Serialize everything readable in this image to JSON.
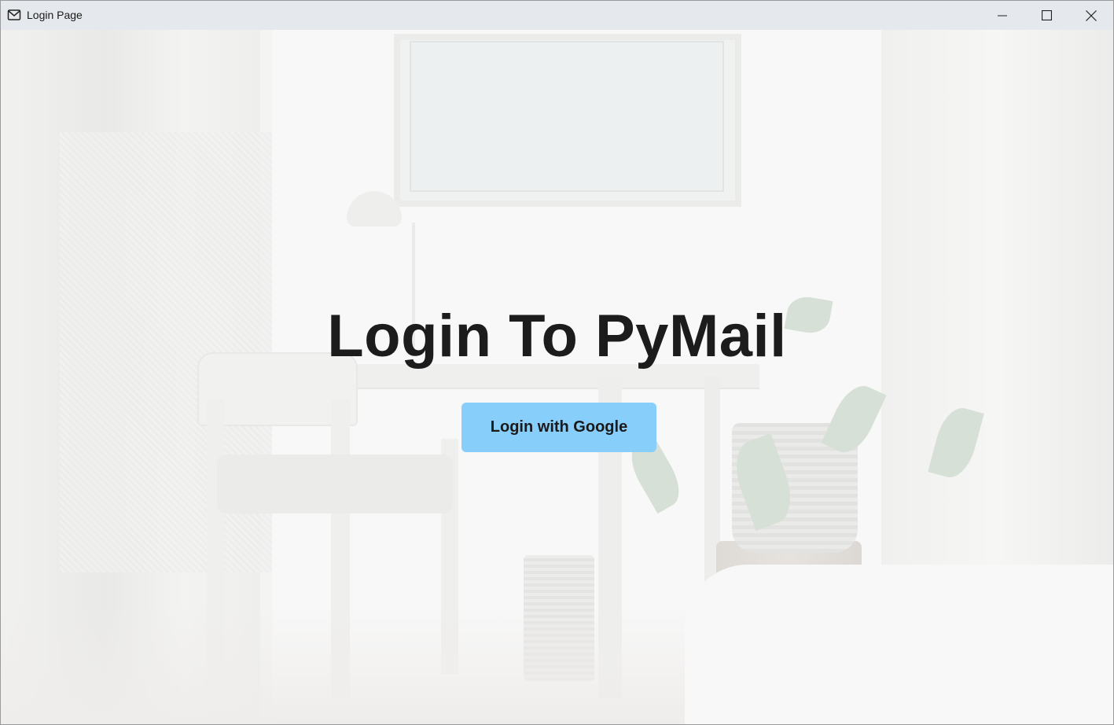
{
  "window": {
    "title": "Login Page",
    "app_icon": "mail-icon",
    "controls": {
      "minimize_icon": "minimize-icon",
      "maximize_icon": "maximize-icon",
      "close_icon": "close-icon"
    }
  },
  "main": {
    "heading": "Login To PyMail",
    "login_button_label": "Login with Google"
  },
  "colors": {
    "titlebar_bg": "#e5e8ed",
    "button_bg": "#87cefa",
    "heading_text": "#1c1c1c"
  }
}
